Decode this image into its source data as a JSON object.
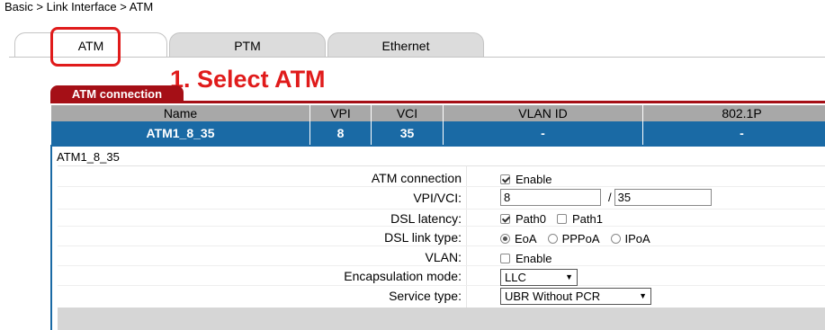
{
  "breadcrumb": "Basic > Link Interface > ATM",
  "tabs": [
    {
      "label": "ATM"
    },
    {
      "label": "PTM"
    },
    {
      "label": "Ethernet"
    }
  ],
  "annotation": "1. Select ATM",
  "annotation_color": "#e01b1b",
  "section_tab": "ATM connection",
  "accent_color": "#a50f16",
  "selected_row_color": "#1a6aa5",
  "table": {
    "headers": [
      "Name",
      "VPI",
      "VCI",
      "VLAN ID",
      "802.1P"
    ],
    "rows": [
      [
        "ATM1_8_35",
        "8",
        "35",
        "-",
        "-"
      ]
    ]
  },
  "detail": {
    "title": "ATM1_8_35",
    "fields": {
      "atm_connection": {
        "label": "ATM connection",
        "option": "Enable",
        "checked": true
      },
      "vpi_vci": {
        "label": "VPI/VCI:",
        "vpi": "8",
        "separator": "/",
        "vci": "35"
      },
      "dsl_latency": {
        "label": "DSL latency:",
        "options": [
          "Path0",
          "Path1"
        ],
        "checked": [
          true,
          false
        ]
      },
      "dsl_link_type": {
        "label": "DSL link type:",
        "options": [
          "EoA",
          "PPPoA",
          "IPoA"
        ],
        "selected": "EoA"
      },
      "vlan": {
        "label": "VLAN:",
        "option": "Enable",
        "checked": false
      },
      "encapsulation": {
        "label": "Encapsulation mode:",
        "value": "LLC"
      },
      "service_type": {
        "label": "Service type:",
        "value": "UBR Without PCR"
      }
    }
  }
}
